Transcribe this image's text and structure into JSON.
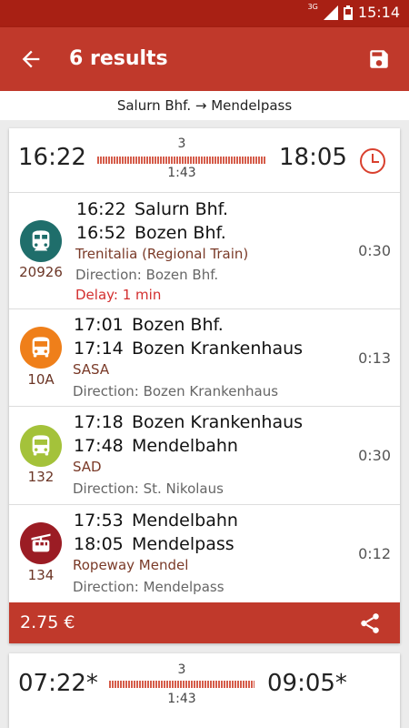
{
  "status_bar": {
    "network": "3G",
    "time": "15:14"
  },
  "app_bar": {
    "title": "6 results",
    "back_icon": "arrow-left-icon",
    "save_icon": "save-icon"
  },
  "route": {
    "text": "Salurn Bhf. → Mendelpass"
  },
  "results": [
    {
      "departure": "16:22",
      "arrival": "18:05",
      "changes": "3",
      "duration": "1:43",
      "price": "2.75 €",
      "legs": [
        {
          "line": "20926",
          "mode": "train",
          "color": "#1f6e6b",
          "from_time": "16:22",
          "from_stop": "Salurn Bhf.",
          "to_time": "16:52",
          "to_stop": "Bozen Bhf.",
          "operator": "Trenitalia (Regional Train)",
          "direction": "Direction: Bozen Bhf.",
          "delay": "Delay: 1 min",
          "duration": "0:30"
        },
        {
          "line": "10A",
          "mode": "bus",
          "color": "#ef7f1a",
          "from_time": "17:01",
          "from_stop": "Bozen Bhf.",
          "to_time": "17:14",
          "to_stop": "Bozen Krankenhaus",
          "operator": "SASA",
          "direction": "Direction: Bozen Krankenhaus",
          "duration": "0:13"
        },
        {
          "line": "132",
          "mode": "bus",
          "color": "#a4c23a",
          "from_time": "17:18",
          "from_stop": "Bozen Krankenhaus",
          "to_time": "17:48",
          "to_stop": "Mendelbahn",
          "operator": "SAD",
          "direction": "Direction: St. Nikolaus",
          "duration": "0:30"
        },
        {
          "line": "134",
          "mode": "cable-car",
          "color": "#9b1c24",
          "from_time": "17:53",
          "from_stop": "Mendelbahn",
          "to_time": "18:05",
          "to_stop": "Mendelpass",
          "operator": "Ropeway Mendel",
          "direction": "Direction: Mendelpass",
          "duration": "0:12"
        }
      ]
    },
    {
      "departure": "07:22*",
      "arrival": "09:05*",
      "changes": "3",
      "duration": "1:43"
    }
  ],
  "colors": {
    "primary": "#c0392b",
    "status_bar": "#a82014",
    "delay": "#d32f2f"
  }
}
